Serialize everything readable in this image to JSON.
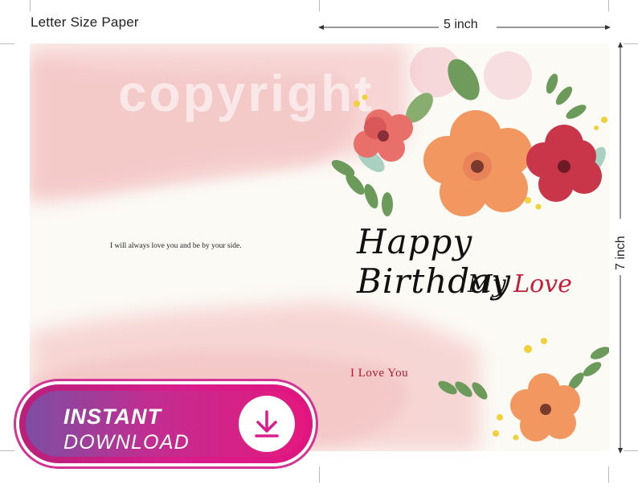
{
  "header": {
    "paper_label": "Letter Size Paper"
  },
  "dimensions": {
    "width_label": "5 inch",
    "height_label": "7 inch"
  },
  "card": {
    "watermark": "copyright",
    "inside_message": "I will always love you and be by your side.",
    "front_title": "Happy Birthday",
    "front_subtitle_prefix": "My",
    "front_subtitle_highlight": "Love",
    "back_text": "I Love You"
  },
  "badge": {
    "line1": "INSTANT",
    "line2": "DOWNLOAD",
    "icon": "download-icon"
  },
  "colors": {
    "accent_pink": "#e0157f",
    "accent_purple": "#7d4ea3",
    "love_red": "#c41f3a",
    "card_bg": "#fbfaf5"
  }
}
